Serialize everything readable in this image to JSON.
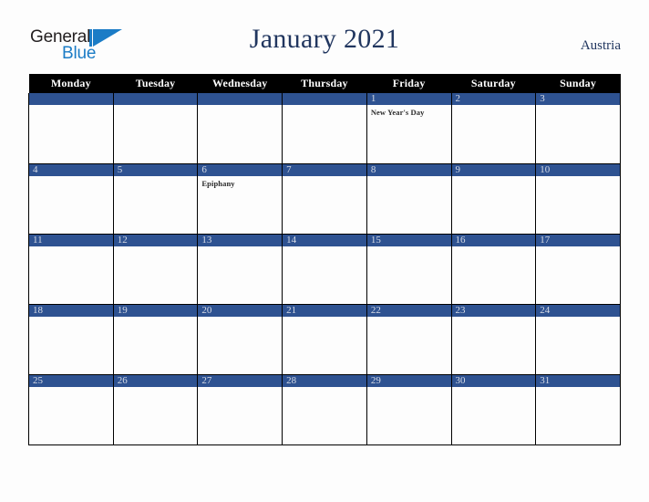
{
  "brand": {
    "name_part1": "General",
    "name_part2": "Blue",
    "mark": "triangle-flag-icon"
  },
  "header": {
    "title": "January 2021",
    "country": "Austria"
  },
  "colors": {
    "accent_blue": "#2e5291",
    "header_black": "#000000",
    "title_navy": "#21365f",
    "logo_blue": "#1b7cc6",
    "page_background": "#fdfdfd"
  },
  "calendar": {
    "weekday_headers": [
      "Monday",
      "Tuesday",
      "Wednesday",
      "Thursday",
      "Friday",
      "Saturday",
      "Sunday"
    ],
    "weeks": [
      [
        {
          "day": "",
          "events": []
        },
        {
          "day": "",
          "events": []
        },
        {
          "day": "",
          "events": []
        },
        {
          "day": "",
          "events": []
        },
        {
          "day": "1",
          "events": [
            "New Year's Day"
          ]
        },
        {
          "day": "2",
          "events": []
        },
        {
          "day": "3",
          "events": []
        }
      ],
      [
        {
          "day": "4",
          "events": []
        },
        {
          "day": "5",
          "events": []
        },
        {
          "day": "6",
          "events": [
            "Epiphany"
          ]
        },
        {
          "day": "7",
          "events": []
        },
        {
          "day": "8",
          "events": []
        },
        {
          "day": "9",
          "events": []
        },
        {
          "day": "10",
          "events": []
        }
      ],
      [
        {
          "day": "11",
          "events": []
        },
        {
          "day": "12",
          "events": []
        },
        {
          "day": "13",
          "events": []
        },
        {
          "day": "14",
          "events": []
        },
        {
          "day": "15",
          "events": []
        },
        {
          "day": "16",
          "events": []
        },
        {
          "day": "17",
          "events": []
        }
      ],
      [
        {
          "day": "18",
          "events": []
        },
        {
          "day": "19",
          "events": []
        },
        {
          "day": "20",
          "events": []
        },
        {
          "day": "21",
          "events": []
        },
        {
          "day": "22",
          "events": []
        },
        {
          "day": "23",
          "events": []
        },
        {
          "day": "24",
          "events": []
        }
      ],
      [
        {
          "day": "25",
          "events": []
        },
        {
          "day": "26",
          "events": []
        },
        {
          "day": "27",
          "events": []
        },
        {
          "day": "28",
          "events": []
        },
        {
          "day": "29",
          "events": []
        },
        {
          "day": "30",
          "events": []
        },
        {
          "day": "31",
          "events": []
        }
      ]
    ]
  }
}
